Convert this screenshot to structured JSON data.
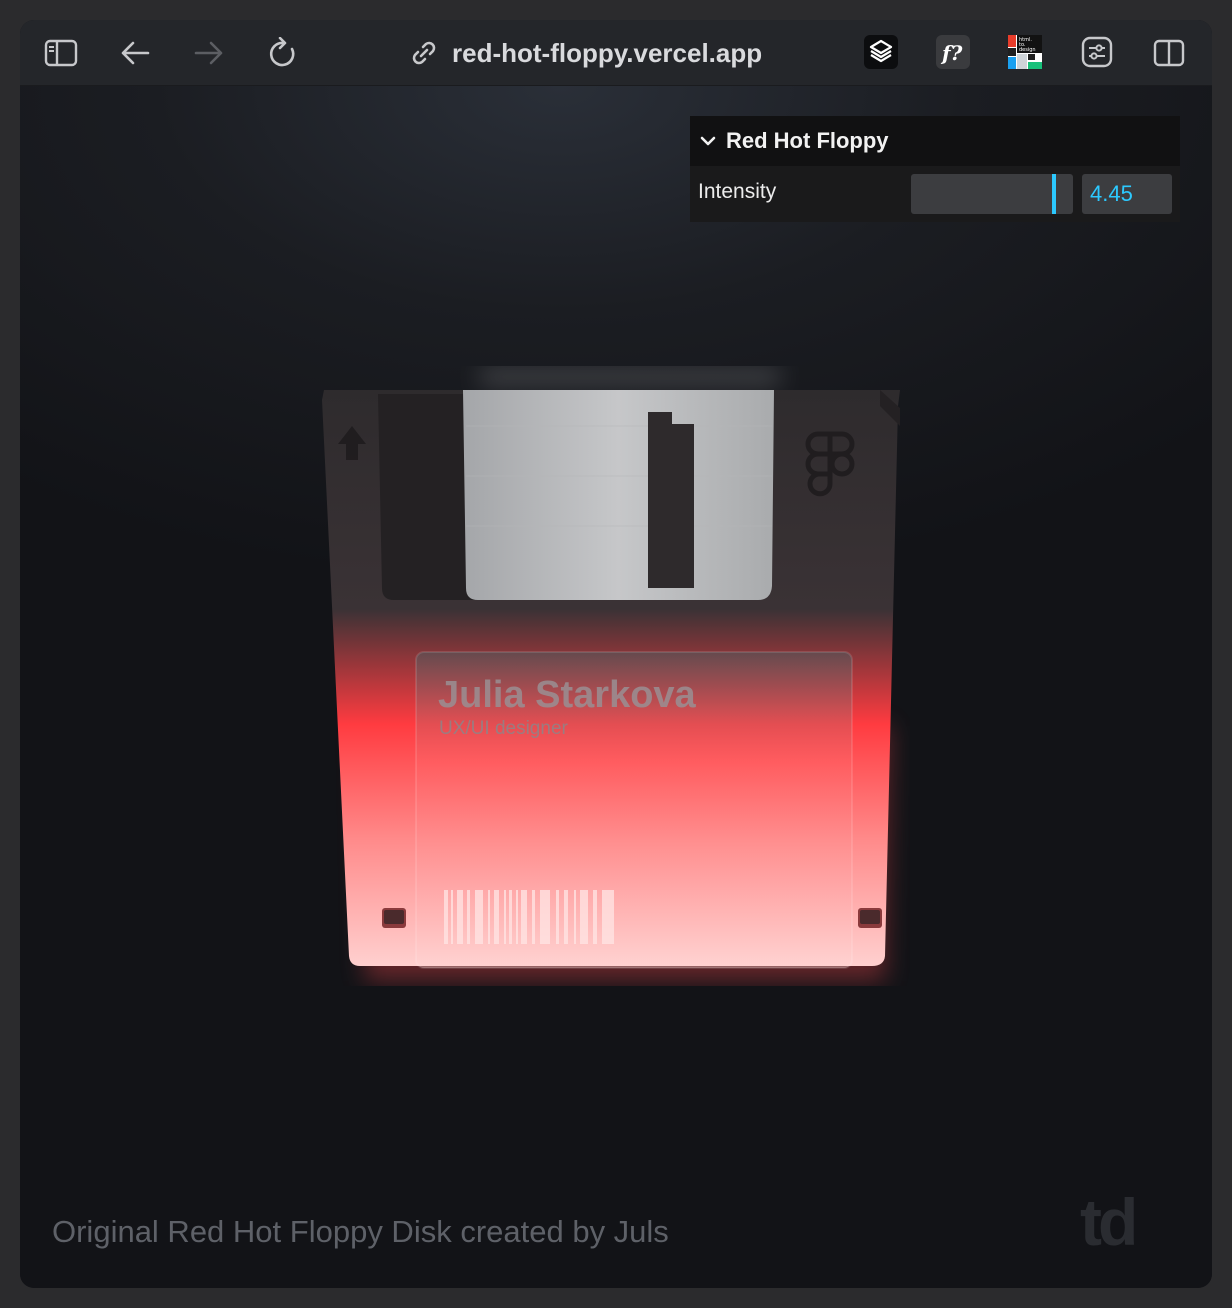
{
  "browser": {
    "url": "red-hot-floppy.vercel.app",
    "extensions": [
      "framer-icon",
      "fontsninja-icon",
      "html-to-design-icon",
      "adjustments-icon"
    ],
    "html_to_design_label": "html. to. design"
  },
  "gui": {
    "title": "Red Hot Floppy",
    "intensity_label": "Intensity",
    "intensity_value": "4.45",
    "slider_fraction": 0.89,
    "accent": "#2cc9ff"
  },
  "floppy": {
    "name": "Julia Starkova",
    "role": "UX/UI designer",
    "glow_color": "#ff3b3f"
  },
  "footer": {
    "credit": "Original Red Hot Floppy Disk created by Juls",
    "logo": "td"
  }
}
